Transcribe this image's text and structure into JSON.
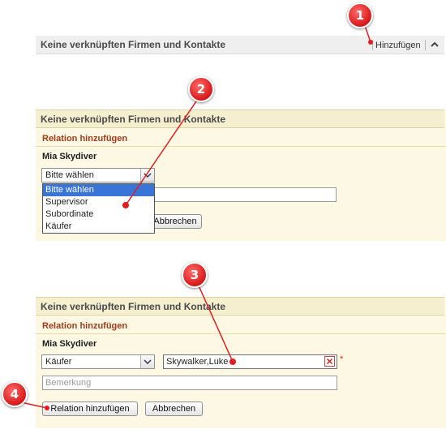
{
  "step1": {
    "title": "Keine verknüpften Firmen und Kontakte",
    "add_link": "Hinzufügen"
  },
  "step2": {
    "title": "Keine verknüpften Firmen und Kontakte",
    "section_title": "Relation hinzufügen",
    "person": "Mia Skydiver",
    "select_value": "Bitte wählen",
    "options": [
      "Bitte wählen",
      "Supervisor",
      "Subordinate",
      "Käufer"
    ],
    "cancel": "Abbrechen"
  },
  "step3": {
    "title": "Keine verknüpften Firmen und Kontakte",
    "section_title": "Relation hinzufügen",
    "person": "Mia Skydiver",
    "select_value": "Käufer",
    "contact_value": "Skywalker,Luke",
    "required_mark": "*",
    "remark_placeholder": "Bemerkung",
    "add_relation": "Relation hinzufügen",
    "cancel": "Abbrechen"
  },
  "callouts": [
    "1",
    "2",
    "3",
    "4"
  ],
  "colors": {
    "callout": "#d81818",
    "section_title": "#a33b1a",
    "panel_bg": "#fcf8e3",
    "selected_option": "#3875d7"
  }
}
